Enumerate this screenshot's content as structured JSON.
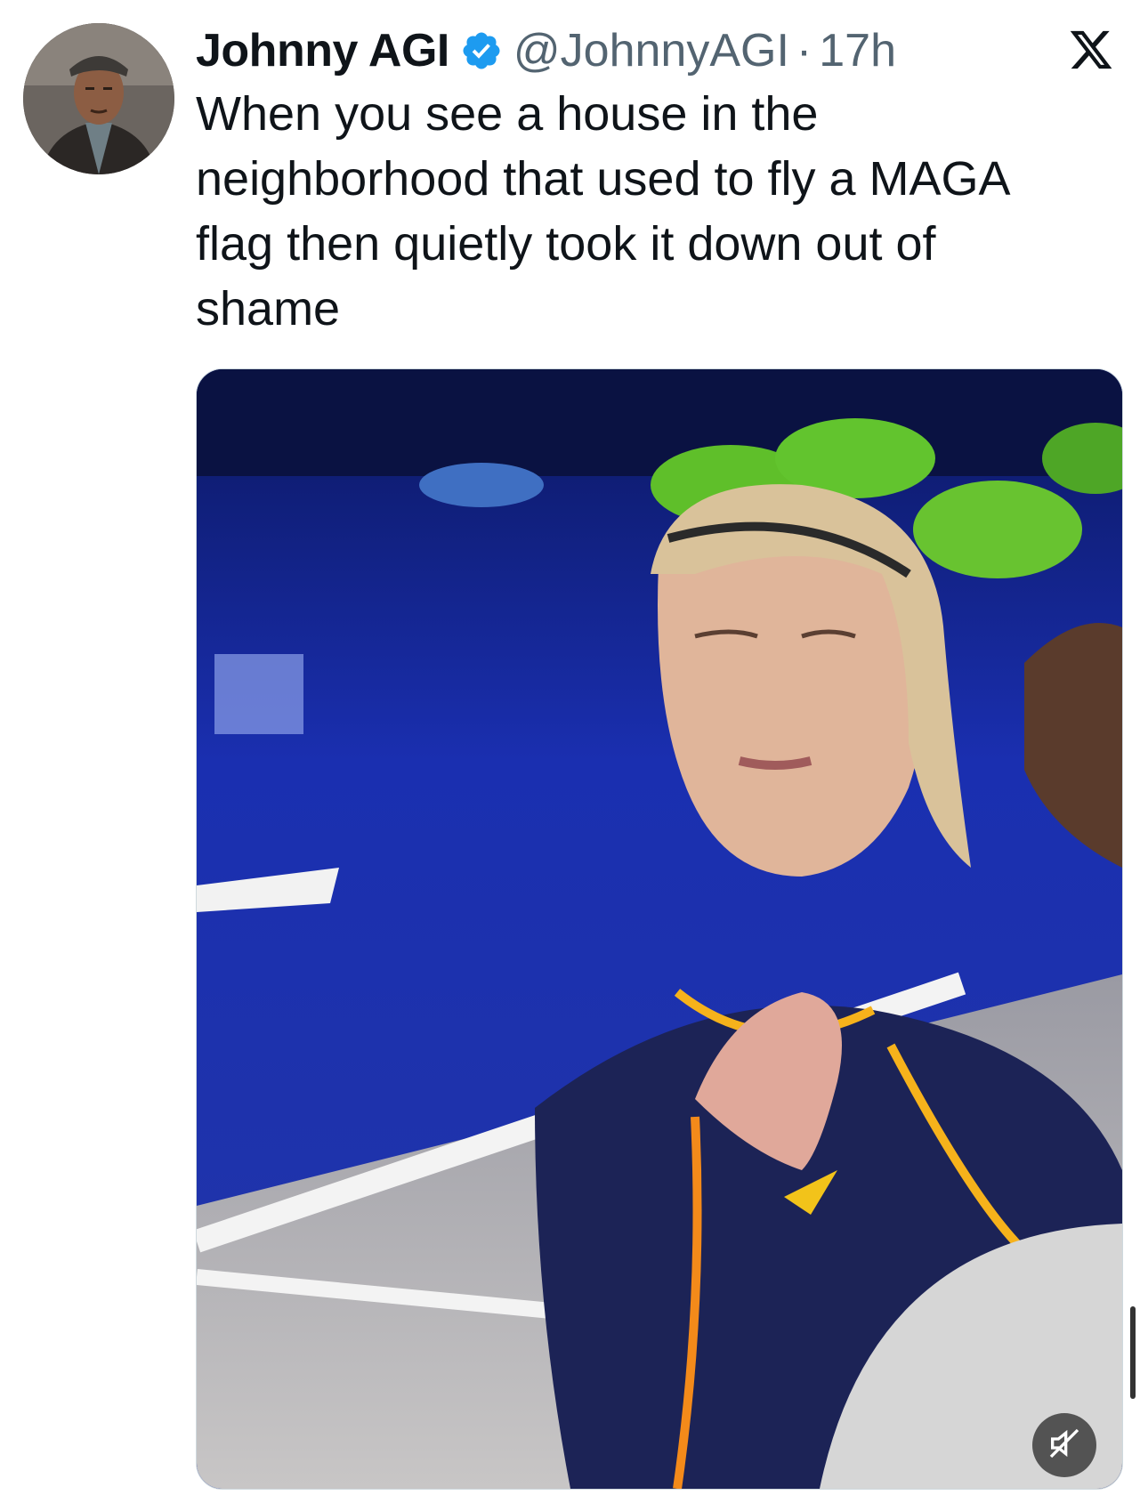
{
  "tweet": {
    "author_name": "Johnny AGI",
    "handle": "@JohnnyAGI",
    "separator": "·",
    "time": "17h",
    "text": "When you see a house in the neighborhood that used to fly a MAGA flag then quietly took it down out of shame"
  },
  "icons": {
    "verified": "verified-badge-icon",
    "platform": "x-logo-icon",
    "mute": "muted-speaker-icon"
  },
  "colors": {
    "verified_blue": "#1d9bf0",
    "text": "#0f1419",
    "secondary_text": "#536471"
  }
}
